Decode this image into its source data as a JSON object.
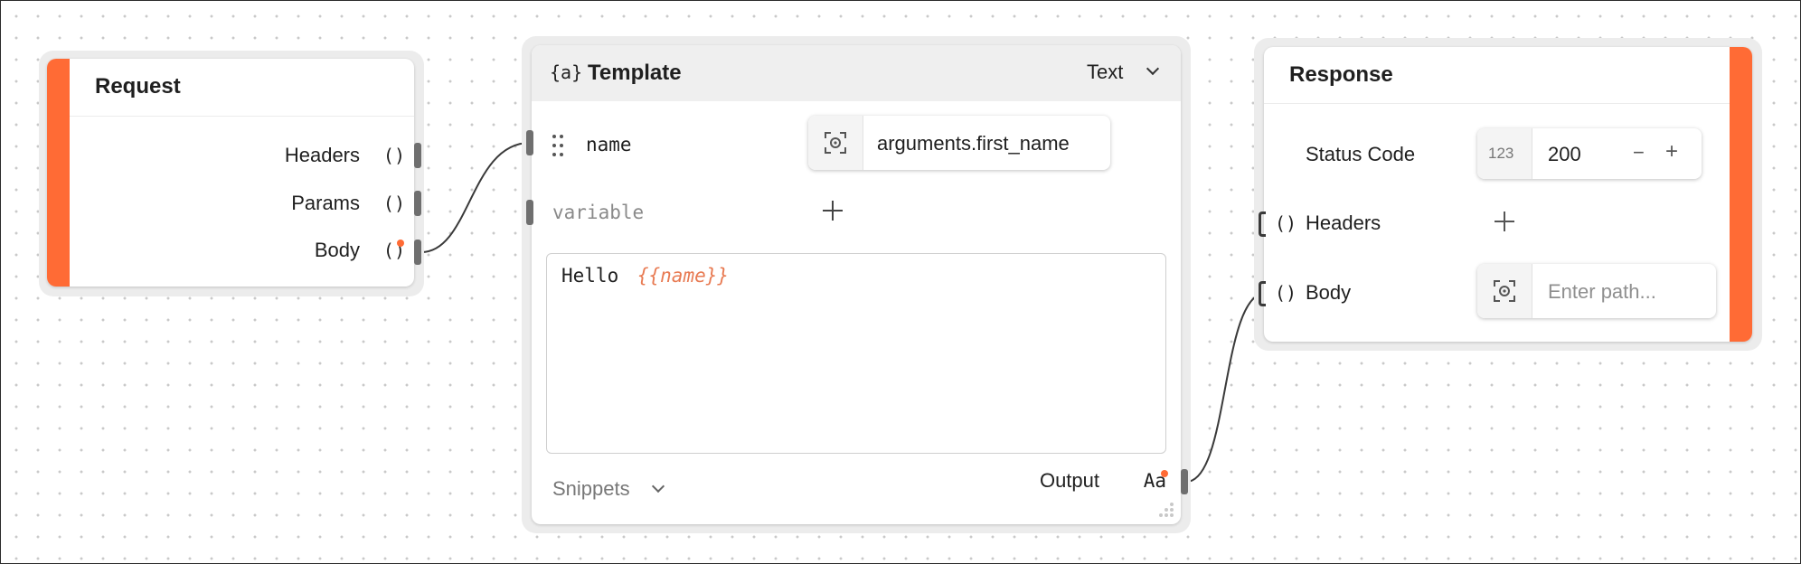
{
  "request": {
    "title": "Request",
    "rows": [
      {
        "label": "Headers",
        "icon": "()"
      },
      {
        "label": "Params",
        "icon": "()"
      },
      {
        "label": "Body",
        "icon": "()"
      }
    ],
    "accent": "#ff6b35"
  },
  "template": {
    "icon": "{a}",
    "title": "Template",
    "mode": "Text",
    "variable_name": "name",
    "variable_value": "arguments.first_name",
    "new_variable_placeholder": "variable",
    "body_prefix": "Hello",
    "body_var": "{{name}}",
    "snippets_label": "Snippets",
    "output_label": "Output",
    "output_icon": "Aa"
  },
  "response": {
    "title": "Response",
    "status_label": "Status Code",
    "status_type_icon": "123",
    "status_value": "200",
    "minus": "−",
    "plus": "+",
    "headers_icon": "()",
    "headers_label": "Headers",
    "body_icon": "()",
    "body_label": "Body",
    "body_placeholder": "Enter path..."
  },
  "colors": {
    "accent": "#ff6b35",
    "template_var": "#e87a52"
  }
}
